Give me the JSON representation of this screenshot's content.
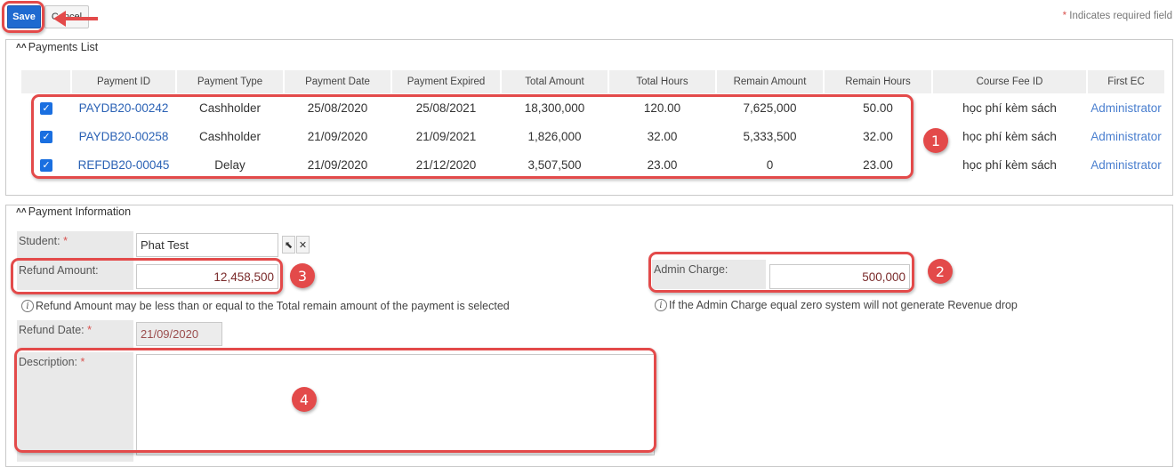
{
  "toolbar": {
    "save_label": "Save",
    "cancel_label": "Cancel",
    "required_note_star": "*",
    "required_note": "Indicates required field"
  },
  "payments_list": {
    "title": "Payments List",
    "columns": [
      "",
      "Payment ID",
      "Payment Type",
      "Payment Date",
      "Payment Expired",
      "Total Amount",
      "Total Hours",
      "Remain Amount",
      "Remain Hours",
      "Course Fee ID",
      "First EC"
    ],
    "rows": [
      {
        "checked": true,
        "payment_id": "PAYDB20-00242",
        "payment_type": "Cashholder",
        "payment_date": "25/08/2020",
        "payment_expired": "25/08/2021",
        "total_amount": "18,300,000",
        "total_hours": "120.00",
        "remain_amount": "7,625,000",
        "remain_hours": "50.00",
        "course_fee_id": "học phí kèm sách",
        "first_ec": "Administrator"
      },
      {
        "checked": true,
        "payment_id": "PAYDB20-00258",
        "payment_type": "Cashholder",
        "payment_date": "21/09/2020",
        "payment_expired": "21/09/2021",
        "total_amount": "1,826,000",
        "total_hours": "32.00",
        "remain_amount": "5,333,500",
        "remain_hours": "32.00",
        "course_fee_id": "học phí kèm sách",
        "first_ec": "Administrator"
      },
      {
        "checked": true,
        "payment_id": "REFDB20-00045",
        "payment_type": "Delay",
        "payment_date": "21/09/2020",
        "payment_expired": "21/12/2020",
        "total_amount": "3,507,500",
        "total_hours": "23.00",
        "remain_amount": "0",
        "remain_hours": "23.00",
        "course_fee_id": "học phí kèm sách",
        "first_ec": "Administrator"
      }
    ]
  },
  "payment_info": {
    "title": "Payment Information",
    "student_label": "Student:",
    "student_value": "Phat Test",
    "refund_amount_label": "Refund Amount:",
    "refund_amount_value": "12,458,500",
    "refund_hint": "Refund Amount may be less than or equal to the Total remain amount of the payment is selected",
    "admin_charge_label": "Admin Charge:",
    "admin_charge_value": "500,000",
    "admin_hint": "If the Admin Charge equal zero system will not generate Revenue drop",
    "refund_date_label": "Refund Date:",
    "refund_date_value": "21/09/2020",
    "description_label": "Description:",
    "description_value": "",
    "required_star": "*"
  },
  "annotations": [
    "1",
    "2",
    "3",
    "4"
  ],
  "colors": {
    "accent": "#1f6ad0",
    "annotation": "#e34a4a",
    "link": "#2b62b5"
  },
  "icons": [
    "collapse-chevron-icon",
    "checkbox-checked-icon",
    "select-pointer-icon",
    "clear-x-icon",
    "info-icon",
    "left-arrow-icon"
  ]
}
